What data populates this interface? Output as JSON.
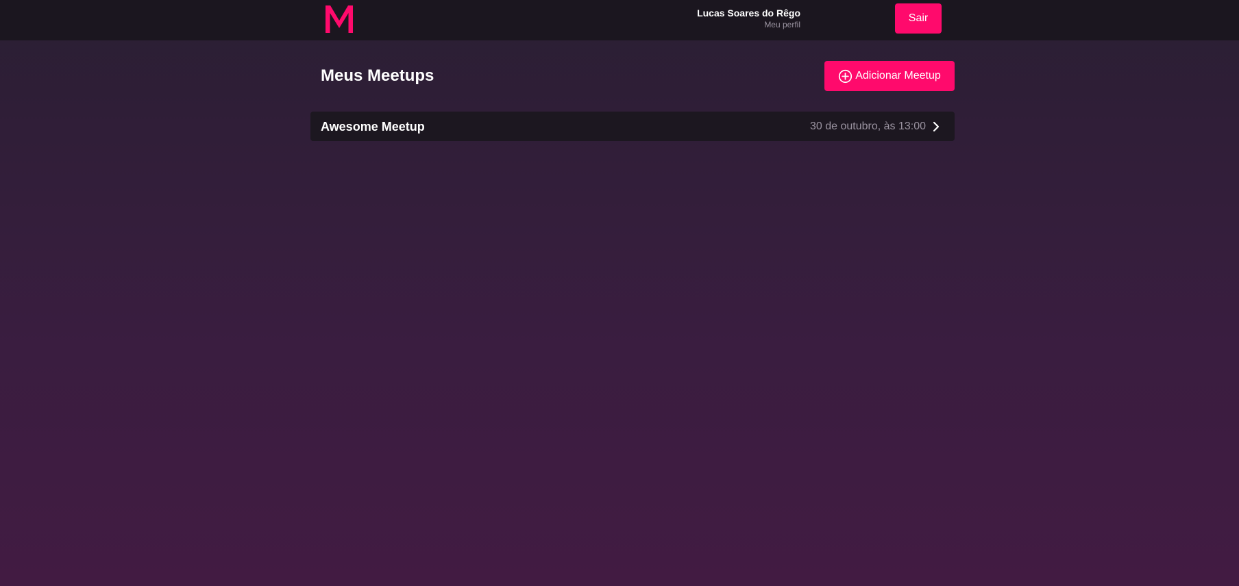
{
  "brand": {
    "logo_letter": "M",
    "accent_color": "#ff0a6c"
  },
  "header": {
    "user_name": "Lucas Soares do Rêgo",
    "profile_link": "Meu perfil",
    "logout_label": "Sair"
  },
  "page": {
    "title": "Meus Meetups",
    "add_button_label": "Adicionar Meetup",
    "add_icon": "plus-circle-icon"
  },
  "meetups": [
    {
      "title": "Awesome Meetup",
      "date": "30 de outubro, às 13:00",
      "icon": "chevron-right-icon"
    }
  ]
}
